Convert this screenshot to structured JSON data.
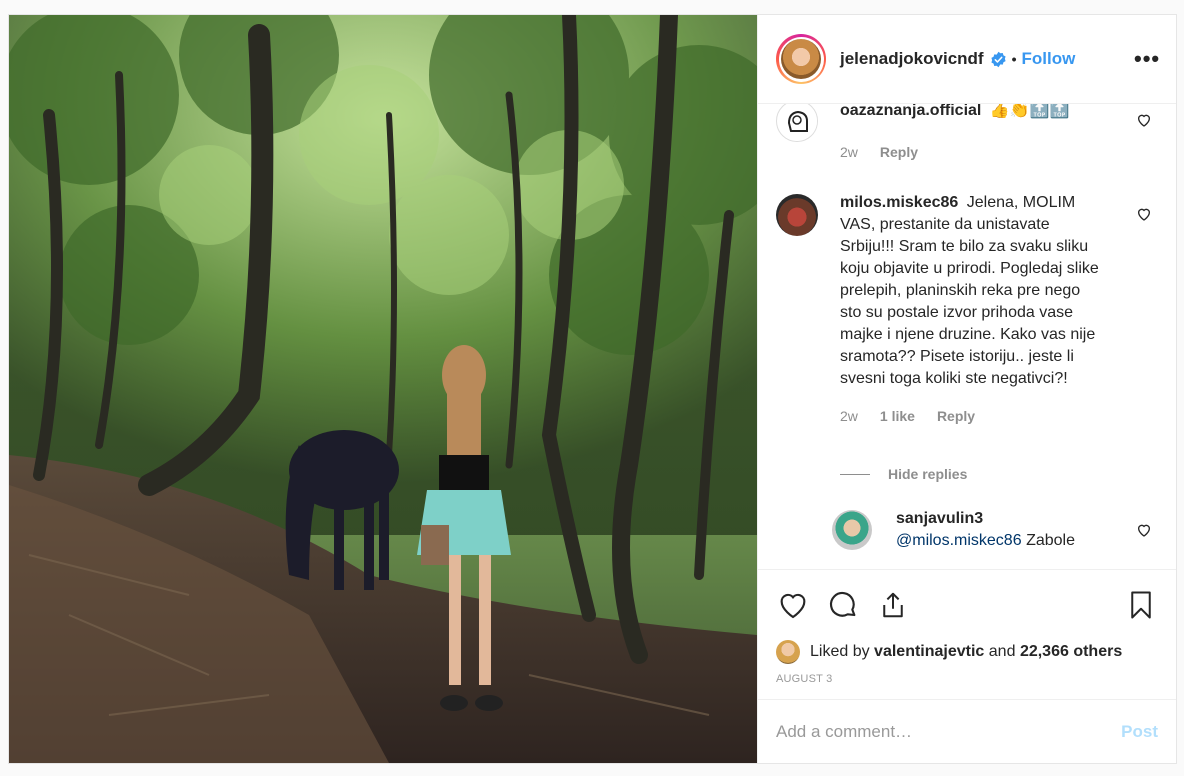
{
  "header": {
    "username": "jelenadjokovicndf",
    "separator": "•",
    "follow_label": "Follow",
    "more_label": "•••"
  },
  "comments": [
    {
      "username": "oazaznanja.official",
      "text": "👍👏🔝🔝",
      "time": "2w",
      "reply_label": "Reply"
    },
    {
      "username": "milos.miskec86",
      "text": "Jelena, MOLIM VAS, prestanite da unistavate Srbiju!!! Sram te bilo za svaku sliku koju objavite u prirodi. Pogledaj slike prelepih, planinskih reka pre nego sto su postale izvor prihoda vase majke i njene druzine. Kako vas nije sramota?? Pisete istoriju.. jeste li svesni toga koliki ste negativci?!",
      "time": "2w",
      "likes_label": "1 like",
      "reply_label": "Reply",
      "hide_replies_label": "Hide replies"
    },
    {
      "username": "sanjavulin3",
      "mention": "@milos.miskec86",
      "text": "Zabole"
    }
  ],
  "likes": {
    "prefix": "Liked by",
    "user": "valentinajevtic",
    "connector": "and",
    "others": "22,366 others"
  },
  "date": "AUGUST 3",
  "add_comment": {
    "placeholder": "Add a comment…",
    "post_label": "Post"
  },
  "icons": {
    "verified": "verified-badge-icon",
    "like": "heart-icon",
    "comment": "comment-bubble-icon",
    "share": "share-icon",
    "save": "bookmark-icon"
  },
  "colors": {
    "link": "#3897f0",
    "verified": "#3897f0",
    "post_disabled": "#b2dffc",
    "meta": "#8e8e8e"
  }
}
